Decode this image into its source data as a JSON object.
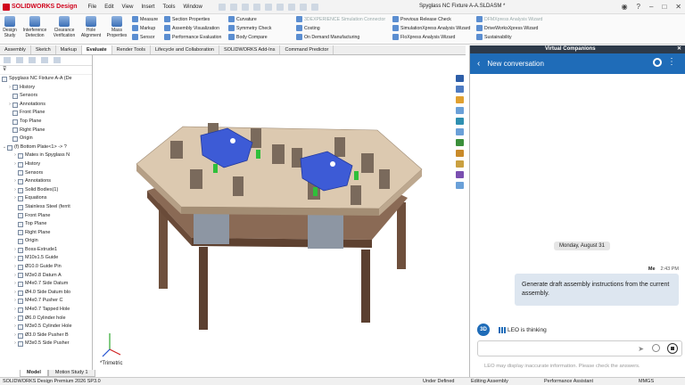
{
  "app": {
    "brand": "SOLIDWORKS Design",
    "document_title": "Spyglass NC Fixture A-A.SLDASM *",
    "menu": [
      "File",
      "Edit",
      "View",
      "Insert",
      "Tools",
      "Window"
    ]
  },
  "ribbon": {
    "large_buttons": [
      "Design Study",
      "Interference Detection",
      "Clearance Verification",
      "Hole Alignment",
      "Mass Properties"
    ],
    "group1": [
      "Measure",
      "Markup",
      "Sensor"
    ],
    "group2": [
      "Section Properties",
      "Assembly Visualization",
      "Performance Evaluation"
    ],
    "group3": [
      "Curvature",
      "Symmetry Check",
      "Body Compare"
    ],
    "group4": [
      "3DEXPERIENCE Simulation Connector",
      "Costing",
      "On Demand Manufacturing"
    ],
    "group5": [
      "Previous Release Check",
      "SimulationXpress Analysis Wizard",
      "FloXpress Analysis Wizard"
    ],
    "group6": [
      "DFMXpress Analysis Wizard",
      "DriveWorksXpress Wizard",
      "Sustainability"
    ]
  },
  "tabs": [
    "Assembly",
    "Sketch",
    "Markup",
    "Evaluate",
    "Render Tools",
    "Lifecycle and Collaboration",
    "SOLIDWORKS Add-Ins",
    "Command Predictor"
  ],
  "active_tab": "Evaluate",
  "feature_tree": {
    "root": "Spyglass NC Fixture A-A (De",
    "items": [
      {
        "label": "History",
        "indent": 1,
        "expander": "›"
      },
      {
        "label": "Sensors",
        "indent": 1,
        "expander": ""
      },
      {
        "label": "Annotations",
        "indent": 1,
        "expander": "›"
      },
      {
        "label": "Front Plane",
        "indent": 1,
        "expander": ""
      },
      {
        "label": "Top Plane",
        "indent": 1,
        "expander": ""
      },
      {
        "label": "Right Plane",
        "indent": 1,
        "expander": ""
      },
      {
        "label": "Origin",
        "indent": 1,
        "expander": ""
      },
      {
        "label": "(f) Bottom Plate<1> -> ?",
        "indent": 0,
        "expander": "⌄"
      },
      {
        "label": "Mates in Spyglass N",
        "indent": 2,
        "expander": "›"
      },
      {
        "label": "History",
        "indent": 2,
        "expander": "›"
      },
      {
        "label": "Sensors",
        "indent": 2,
        "expander": ""
      },
      {
        "label": "Annotations",
        "indent": 2,
        "expander": "›"
      },
      {
        "label": "Solid Bodies(1)",
        "indent": 2,
        "expander": "›"
      },
      {
        "label": "Equations",
        "indent": 2,
        "expander": "›"
      },
      {
        "label": "Stainless Steel (ferrit",
        "indent": 2,
        "expander": ""
      },
      {
        "label": "Front Plane",
        "indent": 2,
        "expander": ""
      },
      {
        "label": "Top Plane",
        "indent": 2,
        "expander": ""
      },
      {
        "label": "Right Plane",
        "indent": 2,
        "expander": ""
      },
      {
        "label": "Origin",
        "indent": 2,
        "expander": ""
      },
      {
        "label": "Boss-Extrude1",
        "indent": 2,
        "expander": "›"
      },
      {
        "label": "M10x1.5 Guide",
        "indent": 2,
        "expander": "›"
      },
      {
        "label": "Ø10.0 Guide Pin",
        "indent": 2,
        "expander": "›"
      },
      {
        "label": "M3x0.8 Datum A",
        "indent": 2,
        "expander": "›"
      },
      {
        "label": "M4x0.7 Side Datum",
        "indent": 2,
        "expander": "›"
      },
      {
        "label": "Ø4.0 Side Datum blo",
        "indent": 2,
        "expander": "›"
      },
      {
        "label": "M4x0.7 Pusher C",
        "indent": 2,
        "expander": "›"
      },
      {
        "label": "M4x0.7 Tapped Hole",
        "indent": 2,
        "expander": "›"
      },
      {
        "label": "Ø6.0 Cylinder hole",
        "indent": 2,
        "expander": "›"
      },
      {
        "label": "M3x0.5 Cylinder Hole",
        "indent": 2,
        "expander": "›"
      },
      {
        "label": "Ø3.0 Side Pusher B",
        "indent": 2,
        "expander": "›"
      },
      {
        "label": "M3x0.5 Side Pusher",
        "indent": 2,
        "expander": "›"
      }
    ]
  },
  "bottom_tabs": [
    "Model",
    "Motion Study 1"
  ],
  "viewport": {
    "view_label": "*Trimetric"
  },
  "status_bar": {
    "product": "SOLIDWORKS Design Premium 2026 SP3.0",
    "state": "Under Defined",
    "mode": "Editing Assembly",
    "perf": "Performance Assistant",
    "units": "MMGS"
  },
  "companion": {
    "panel_title": "Virtual Companions",
    "conversation_title": "New conversation",
    "date_divider": "Monday, August 31",
    "message": {
      "sender": "Me",
      "time": "2:43 PM",
      "text": "Generate draft assembly instructions from the current assembly."
    },
    "assistant_status": "LEO is thinking",
    "assistant_avatar": "3D",
    "disclaimer": "LEO may display inaccurate information. Please check the answers."
  },
  "colors": {
    "accent": "#1f6cb8",
    "fixture_plate": "#d9c6ad",
    "clamp_blue": "#3d5bd6",
    "green_part": "#2fbf3a"
  }
}
